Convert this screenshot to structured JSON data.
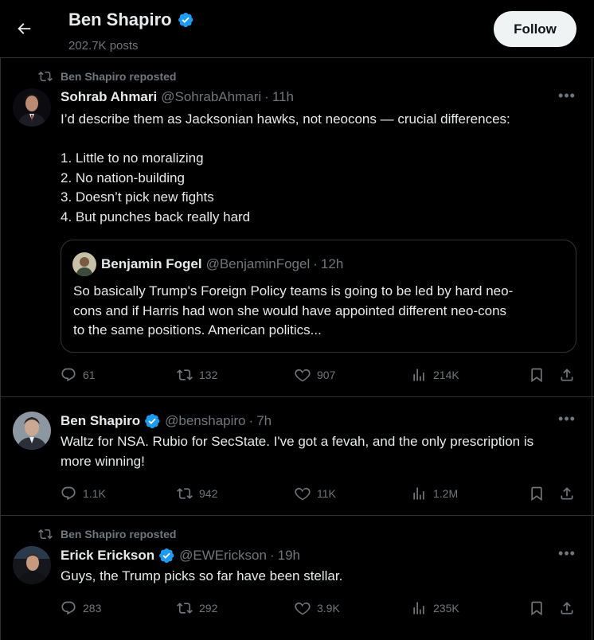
{
  "header": {
    "name": "Ben Shapiro",
    "posts": "202.7K posts",
    "follow_label": "Follow"
  },
  "tweets": [
    {
      "repost_label": "Ben Shapiro reposted",
      "name": "Sohrab Ahmari",
      "handle": "@SohrabAhmari",
      "time": "11h",
      "verified": false,
      "lines": [
        "I’d describe them as Jacksonian hawks, not neocons — crucial differences:",
        "",
        "1. Little to no moralizing",
        "2. No nation-building",
        "3. Doesn’t pick new fights",
        "4. But punches back really hard"
      ],
      "quote": {
        "name": "Benjamin Fogel",
        "handle": "@BenjaminFogel",
        "time": "12h",
        "lines": [
          "So basically Trump's Foreign Policy teams is going to be led by hard neo-",
          "cons and if Harris had won she would have appointed different neo-cons",
          "to the same positions. American politics..."
        ]
      },
      "replies": "61",
      "reposts": "132",
      "likes": "907",
      "views": "214K"
    },
    {
      "name": "Ben Shapiro",
      "handle": "@benshapiro",
      "time": "7h",
      "verified": true,
      "lines": [
        "Waltz for NSA. Rubio for SecState. I've got a fevah, and the only prescription is",
        "more winning!"
      ],
      "replies": "1.1K",
      "reposts": "942",
      "likes": "11K",
      "views": "1.2M"
    },
    {
      "repost_label": "Ben Shapiro reposted",
      "name": "Erick Erickson",
      "handle": "@EWErickson",
      "time": "19h",
      "verified": true,
      "lines": [
        "Guys, the Trump picks so far have been stellar."
      ],
      "replies": "283",
      "reposts": "292",
      "likes": "3.9K",
      "views": "235K"
    }
  ],
  "icons": {
    "back": "arrow-left-icon",
    "verified": "verified-badge-icon",
    "repost": "repost-icon",
    "reply": "reply-icon",
    "like": "heart-icon",
    "views": "views-icon",
    "bookmark": "bookmark-icon",
    "share": "share-icon",
    "more": "more-icon"
  },
  "colors": {
    "background": "#000000",
    "text": "#e7e9ea",
    "muted": "#71767b",
    "border": "#2f3336",
    "verified": "#1d9bf0",
    "follow_bg": "#eff3f4"
  }
}
